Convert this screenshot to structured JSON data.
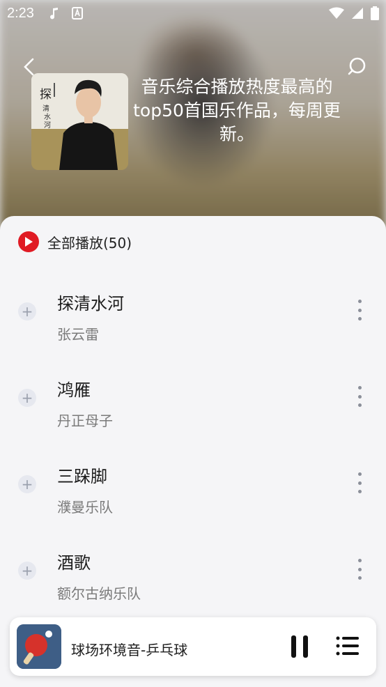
{
  "status_bar": {
    "time": "2:23"
  },
  "header": {
    "description": "音乐综合播放热度最高的top50首国乐作品，每周更新。",
    "cover_text": "探清水河"
  },
  "list": {
    "play_all_label": "全部播放(50)",
    "songs": [
      {
        "title": "探清水河",
        "artist": "张云雷"
      },
      {
        "title": "鸿雁",
        "artist": "丹正母子"
      },
      {
        "title": "三跺脚",
        "artist": "濮曼乐队"
      },
      {
        "title": "酒歌",
        "artist": "额尔古纳乐队"
      }
    ]
  },
  "mini_player": {
    "title": "球场环境音-乒乓球"
  },
  "colors": {
    "accent": "#e01b24",
    "background": "#f5f5f7"
  }
}
